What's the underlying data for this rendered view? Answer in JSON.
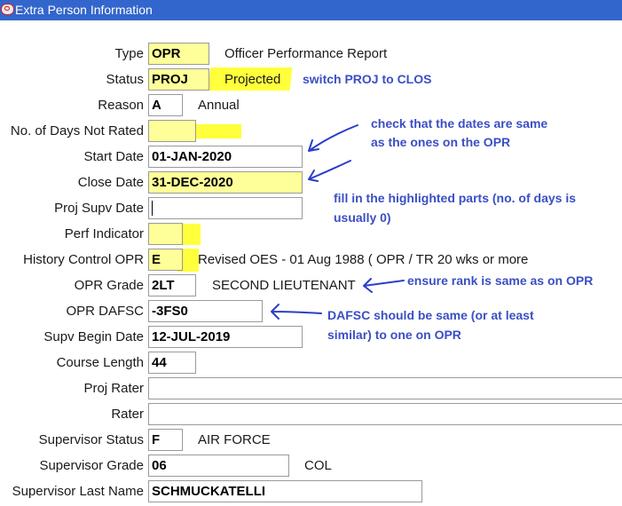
{
  "window": {
    "title": "Extra Person Information"
  },
  "form": {
    "type": {
      "label": "Type",
      "value": "OPR",
      "desc": "Officer Performance Report"
    },
    "status": {
      "label": "Status",
      "value": "PROJ",
      "desc": "Projected"
    },
    "reason": {
      "label": "Reason",
      "value": "A",
      "desc": "Annual"
    },
    "days_not_rated": {
      "label": "No. of Days Not Rated",
      "value": ""
    },
    "start_date": {
      "label": "Start Date",
      "value": "01-JAN-2020"
    },
    "close_date": {
      "label": "Close Date",
      "value": "31-DEC-2020"
    },
    "proj_supv_date": {
      "label": "Proj Supv Date",
      "value": ""
    },
    "perf_indicator": {
      "label": "Perf Indicator",
      "value": ""
    },
    "history_control": {
      "label": "History Control OPR",
      "value": "E",
      "desc": "Revised OES - 01 Aug 1988 ( OPR / TR 20 wks or more"
    },
    "opr_grade": {
      "label": "OPR Grade",
      "value": "2LT",
      "desc": "SECOND LIEUTENANT"
    },
    "opr_dafsc": {
      "label": "OPR DAFSC",
      "value": "-3FS0"
    },
    "supv_begin_date": {
      "label": "Supv Begin Date",
      "value": "12-JUL-2019"
    },
    "course_length": {
      "label": "Course Length",
      "value": "44"
    },
    "proj_rater": {
      "label": "Proj Rater",
      "value": ""
    },
    "rater": {
      "label": "Rater",
      "value": ""
    },
    "supervisor_status": {
      "label": "Supervisor Status",
      "value": "F",
      "desc": "AIR FORCE"
    },
    "supervisor_grade": {
      "label": "Supervisor Grade",
      "value": "06",
      "desc": "COL"
    },
    "supervisor_last_name": {
      "label": "Supervisor Last Name",
      "value": "SCHMUCKATELLI"
    }
  },
  "annotations": {
    "switch_status": "switch PROJ to CLOS",
    "dates_line1": "check that the dates are same",
    "dates_line2": "as the ones on the OPR",
    "fill_line1": "fill in the highlighted parts (no. of days is",
    "fill_line2": "usually 0)",
    "rank": "ensure rank is same as on OPR",
    "dafsc_line1": "DAFSC should be same (or at least",
    "dafsc_line2": "similar) to one on OPR"
  },
  "colors": {
    "titlebar": "#3366cc",
    "field_highlight": "#ffff99",
    "marker_highlight": "#ffff3c",
    "annotation_text": "#3a4fc4"
  }
}
